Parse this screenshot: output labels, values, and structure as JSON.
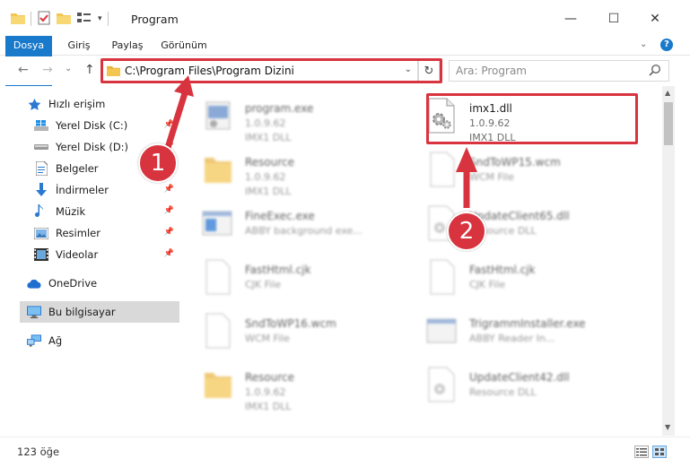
{
  "window": {
    "title": "Program",
    "minimize": "—",
    "maximize": "☐",
    "close": "✕"
  },
  "ribbon": {
    "tabs": [
      "Dosya",
      "Giriş",
      "Paylaş",
      "Görünüm"
    ],
    "help": "?"
  },
  "navigation": {
    "back": "←",
    "forward": "→",
    "recent": "⌄",
    "up": "↑",
    "address": "C:\\Program Files\\Program Dizini",
    "dropdown": "⌄",
    "refresh": "↻",
    "search_placeholder": "Ara: Program"
  },
  "sidebar": {
    "items": [
      {
        "label": "Hızlı erişim",
        "icon": "star-icon"
      },
      {
        "label": "Yerel Disk (C:)",
        "icon": "windows-drive-icon"
      },
      {
        "label": "Yerel Disk (D:)",
        "icon": "drive-icon"
      },
      {
        "label": "Belgeler",
        "icon": "document-icon"
      },
      {
        "label": "İndirmeler",
        "icon": "download-icon"
      },
      {
        "label": "Müzik",
        "icon": "music-icon"
      },
      {
        "label": "Resimler",
        "icon": "pictures-icon"
      },
      {
        "label": "Videolar",
        "icon": "video-icon"
      },
      {
        "label": "OneDrive",
        "icon": "cloud-icon"
      },
      {
        "label": "Bu bilgisayar",
        "icon": "computer-icon"
      },
      {
        "label": "Ağ",
        "icon": "network-icon"
      }
    ]
  },
  "files": [
    {
      "name": "program.exe",
      "line2": "1.0.9.62",
      "line3": "IMX1 DLL"
    },
    {
      "name": "imx1.dll",
      "line2": "1.0.9.62",
      "line3": "IMX1 DLL"
    },
    {
      "name": "Resource",
      "line2": "1.0.9.62",
      "line3": "IMX1 DLL"
    },
    {
      "name": "SndToWP15.wcm",
      "line2": "WCM File",
      "line3": ""
    },
    {
      "name": "FineExec.exe",
      "line2": "ABBY background exe...",
      "line3": ""
    },
    {
      "name": "UpdateClient65.dll",
      "line2": "Resource DLL",
      "line3": ""
    },
    {
      "name": "FastHtml.cjk",
      "line2": "CJK File",
      "line3": ""
    },
    {
      "name": "FastHtml.cjk",
      "line2": "CJK File",
      "line3": ""
    },
    {
      "name": "SndToWP16.wcm",
      "line2": "WCM File",
      "line3": ""
    },
    {
      "name": "TrigrammInstaller.exe",
      "line2": "ABBY Reader In...",
      "line3": ""
    },
    {
      "name": "Resource",
      "line2": "1.0.9.62",
      "line3": "IMX1 DLL"
    },
    {
      "name": "UpdateClient42.dll",
      "line2": "Resource DLL",
      "line3": ""
    }
  ],
  "status": {
    "count": "123 öğe"
  },
  "markers": [
    "1",
    "2"
  ],
  "colors": {
    "accent": "#1979ca",
    "annotation": "#d8343f",
    "folder": "#f4c550"
  }
}
